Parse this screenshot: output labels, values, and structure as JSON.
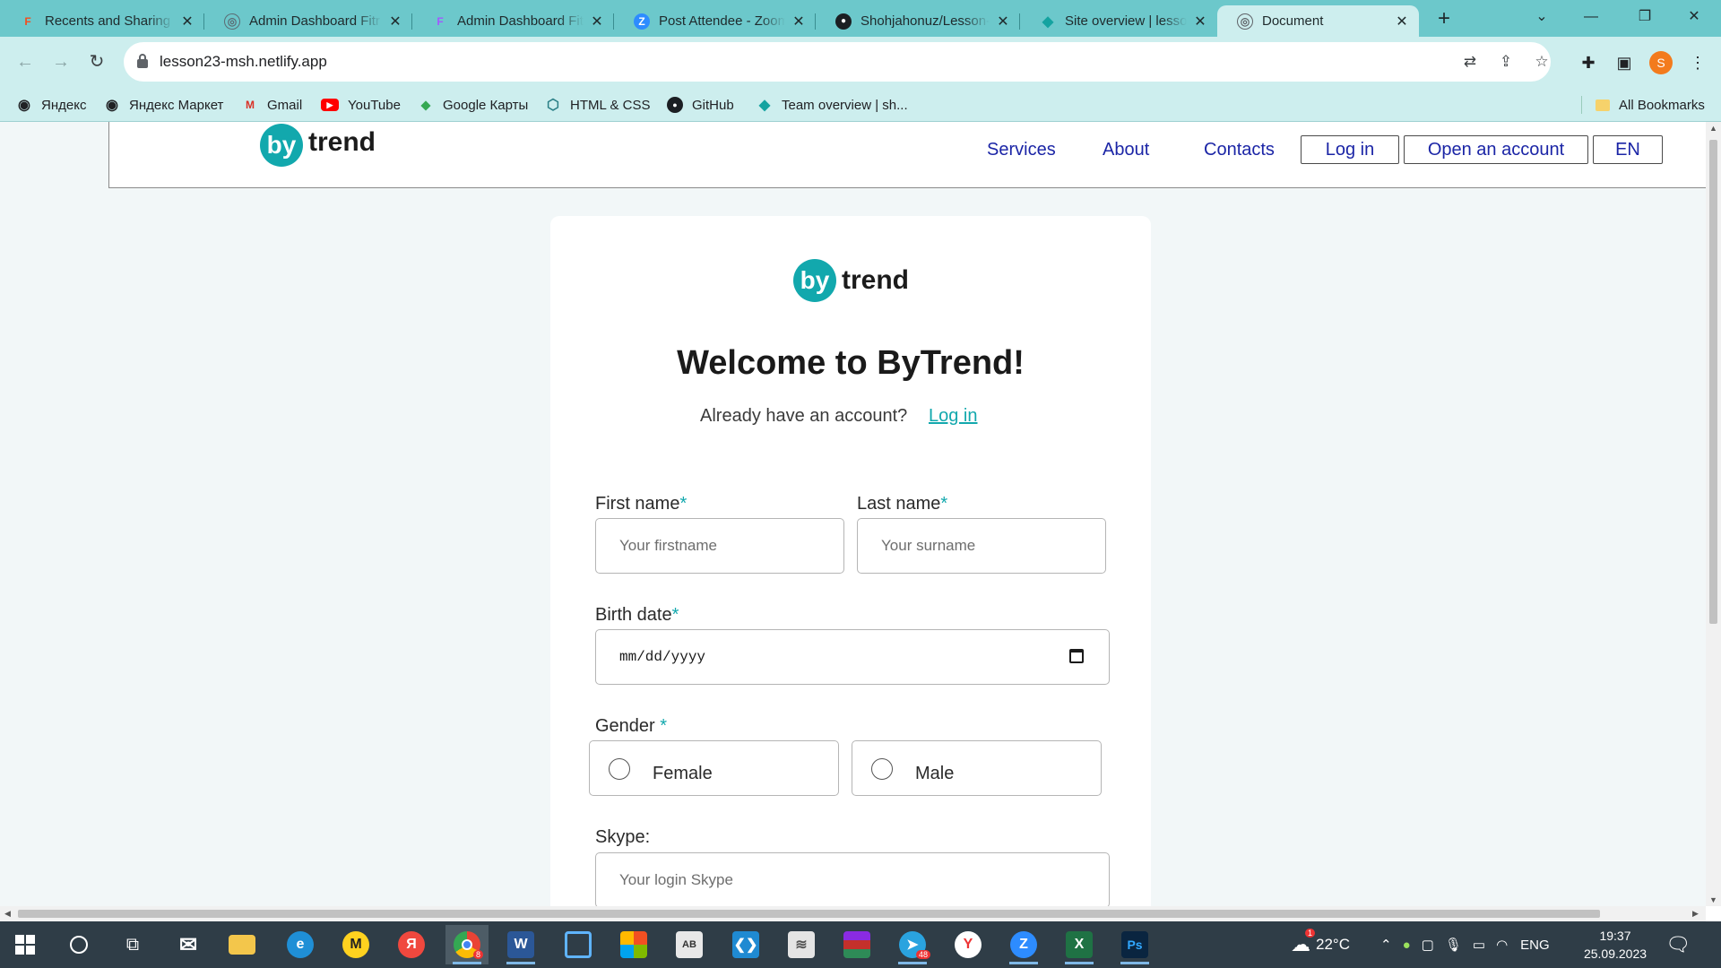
{
  "browser": {
    "tabs": [
      {
        "title": "Recents and Sharing -",
        "favicon": "figma-icon",
        "color": "#f24e1e",
        "glyph": "F"
      },
      {
        "title": "Admin Dashboard Fitr",
        "favicon": "globe-icon",
        "color": "#5b6b73",
        "glyph": "◎"
      },
      {
        "title": "Admin Dashboard Fitr",
        "favicon": "figma-icon",
        "color": "#a259ff",
        "glyph": "F"
      },
      {
        "title": "Post Attendee - Zoom",
        "favicon": "zoom-icon",
        "color": "#2d8cff",
        "glyph": "Z"
      },
      {
        "title": "Shohjahonuz/Lesson-",
        "favicon": "github-icon",
        "color": "#1b1f23",
        "glyph": "●"
      },
      {
        "title": "Site overview | lesson",
        "favicon": "netlify-icon",
        "color": "#14a3a0",
        "glyph": "◆"
      },
      {
        "title": "Document",
        "favicon": "globe-icon",
        "color": "#5f6368",
        "glyph": "◎"
      }
    ],
    "url": "lesson23-msh.netlify.app",
    "profile_initial": "S",
    "bookmarks": [
      {
        "label": "Яндекс",
        "icon": "globe-icon",
        "glyph": "◉",
        "color": "#202124"
      },
      {
        "label": "Яндекс Маркет",
        "icon": "globe-icon",
        "glyph": "◉",
        "color": "#202124"
      },
      {
        "label": "Gmail",
        "icon": "gmail-icon",
        "glyph": "M",
        "color": "#d93025"
      },
      {
        "label": "YouTube",
        "icon": "youtube-icon",
        "glyph": "▶",
        "color": "#ff0000"
      },
      {
        "label": "Google Карты",
        "icon": "maps-pin-icon",
        "glyph": "📍",
        "color": "#34a853"
      },
      {
        "label": "HTML & CSS",
        "icon": "html-css-icon",
        "glyph": "⬡",
        "color": "#2a7f86"
      },
      {
        "label": "GitHub",
        "icon": "github-icon",
        "glyph": "●",
        "color": "#1b1f23"
      },
      {
        "label": "Team overview | sh...",
        "icon": "netlify-icon",
        "glyph": "◆",
        "color": "#14a3a0"
      }
    ],
    "all_bookmarks": "All Bookmarks"
  },
  "site": {
    "logo_by": "by",
    "logo_word": "trend",
    "nav": {
      "services": "Services",
      "about": "About",
      "contacts": "Contacts"
    },
    "login_btn": "Log in",
    "open_account_btn": "Open an account",
    "lang_btn": "EN"
  },
  "form": {
    "title": "Welcome to ByTrend!",
    "have_account": "Already have an account?",
    "login_link": "Log in",
    "first_name_label": "First name",
    "last_name_label": "Last name",
    "birth_date_label": "Birth date",
    "gender_label": "Gender ",
    "required_mark": "*",
    "first_name_placeholder": "Your firstname",
    "last_name_placeholder": "Your surname",
    "birth_date_placeholder": "mm/dd/yyyy",
    "gender_female": "Female",
    "gender_male": "Male",
    "skype_label": "Skype:",
    "skype_placeholder": "Your login Skype"
  },
  "taskbar": {
    "weather": "22°C",
    "weather_badge": "1",
    "language": "ENG",
    "time": "19:37",
    "date": "25.09.2023",
    "telegram_badge": "48",
    "chrome_badge": "8"
  },
  "colors": {
    "accent": "#12a8ad",
    "nav_link": "#1b25a6",
    "tabbar": "#6cc8cb",
    "toolbar": "#cdeeee"
  }
}
